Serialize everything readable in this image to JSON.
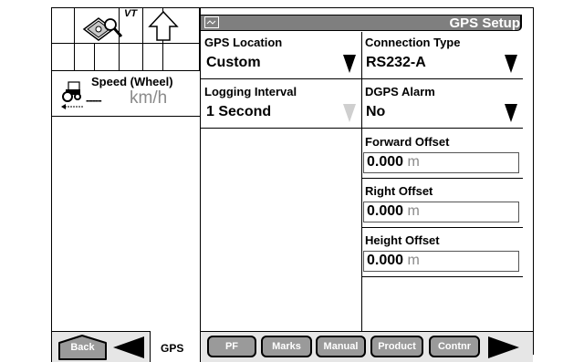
{
  "header": {
    "title": "GPS Setup"
  },
  "left": {
    "vt_badge": "VT",
    "speed": {
      "label": "Speed (Wheel)",
      "dashes": "-----",
      "unit": "km/h"
    }
  },
  "fields": {
    "gps_location": {
      "label": "GPS Location",
      "value": "Custom"
    },
    "connection_type": {
      "label": "Connection Type",
      "value": "RS232-A"
    },
    "logging_interval": {
      "label": "Logging Interval",
      "value": "1 Second"
    },
    "dgps_alarm": {
      "label": "DGPS Alarm",
      "value": "No"
    },
    "forward_offset": {
      "label": "Forward Offset",
      "value": "0.000",
      "unit": "m"
    },
    "right_offset": {
      "label": "Right Offset",
      "value": "0.000",
      "unit": "m"
    },
    "height_offset": {
      "label": "Height Offset",
      "value": "0.000",
      "unit": "m"
    }
  },
  "bottom": {
    "back": "Back",
    "gps_tab": "GPS",
    "pf": "PF",
    "marks": "Marks",
    "manual": "Manual",
    "product": "Product",
    "contnr": "Contnr"
  },
  "colors": {
    "header_bg": "#7f7f7f",
    "button_bg": "#9a9a9a",
    "disabled_text": "#8a8a8a"
  }
}
